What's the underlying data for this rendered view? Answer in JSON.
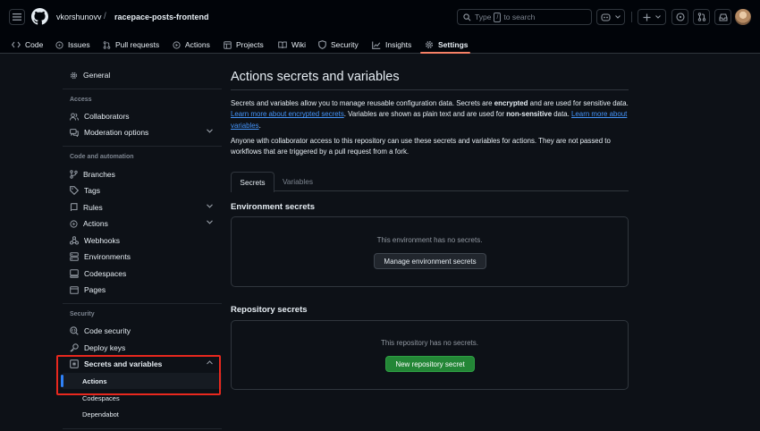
{
  "header": {
    "owner": "vkorshunovv",
    "separator": "/",
    "repo": "racepace-posts-frontend",
    "search_prefix": "Type",
    "search_key": "/",
    "search_suffix": "to search"
  },
  "tabs": [
    {
      "label": "Code",
      "icon": "code-icon"
    },
    {
      "label": "Issues",
      "icon": "issue-icon"
    },
    {
      "label": "Pull requests",
      "icon": "pull-request-icon"
    },
    {
      "label": "Actions",
      "icon": "play-icon"
    },
    {
      "label": "Projects",
      "icon": "table-icon"
    },
    {
      "label": "Wiki",
      "icon": "book-icon"
    },
    {
      "label": "Security",
      "icon": "shield-icon"
    },
    {
      "label": "Insights",
      "icon": "graph-icon"
    },
    {
      "label": "Settings",
      "icon": "gear-icon",
      "active": true
    }
  ],
  "sidebar": {
    "general": "General",
    "access_heading": "Access",
    "collaborators": "Collaborators",
    "moderation": "Moderation options",
    "code_heading": "Code and automation",
    "branches": "Branches",
    "tags": "Tags",
    "rules": "Rules",
    "actions": "Actions",
    "webhooks": "Webhooks",
    "environments": "Environments",
    "codespaces": "Codespaces",
    "pages": "Pages",
    "security_heading": "Security",
    "code_security": "Code security",
    "deploy_keys": "Deploy keys",
    "secrets": "Secrets and variables",
    "sub_actions": "Actions",
    "sub_codespaces": "Codespaces",
    "sub_dependabot": "Dependabot"
  },
  "main": {
    "title": "Actions secrets and variables",
    "p1_a": "Secrets and variables allow you to manage reusable configuration data. Secrets are ",
    "p1_b": "encrypted",
    "p1_c": " and are used for sensitive data. ",
    "p1_link1": "Learn more about encrypted secrets",
    "p1_d": ". Variables are shown as plain text and are used for ",
    "p1_e": "non-sensitive",
    "p1_f": " data. ",
    "p1_link2": "Learn more about variables",
    "p1_g": ".",
    "p2": "Anyone with collaborator access to this repository can use these secrets and variables for actions. They are not passed to workflows that are triggered by a pull request from a fork.",
    "tab_secrets": "Secrets",
    "tab_variables": "Variables",
    "env_heading": "Environment secrets",
    "env_empty": "This environment has no secrets.",
    "env_button": "Manage environment secrets",
    "repo_heading": "Repository secrets",
    "repo_empty": "This repository has no secrets.",
    "repo_button": "New repository secret"
  },
  "colors": {
    "accent_blue": "#2f81f7",
    "primary_green": "#238636",
    "tab_underline": "#f78166",
    "highlight_red": "#e8281e"
  }
}
